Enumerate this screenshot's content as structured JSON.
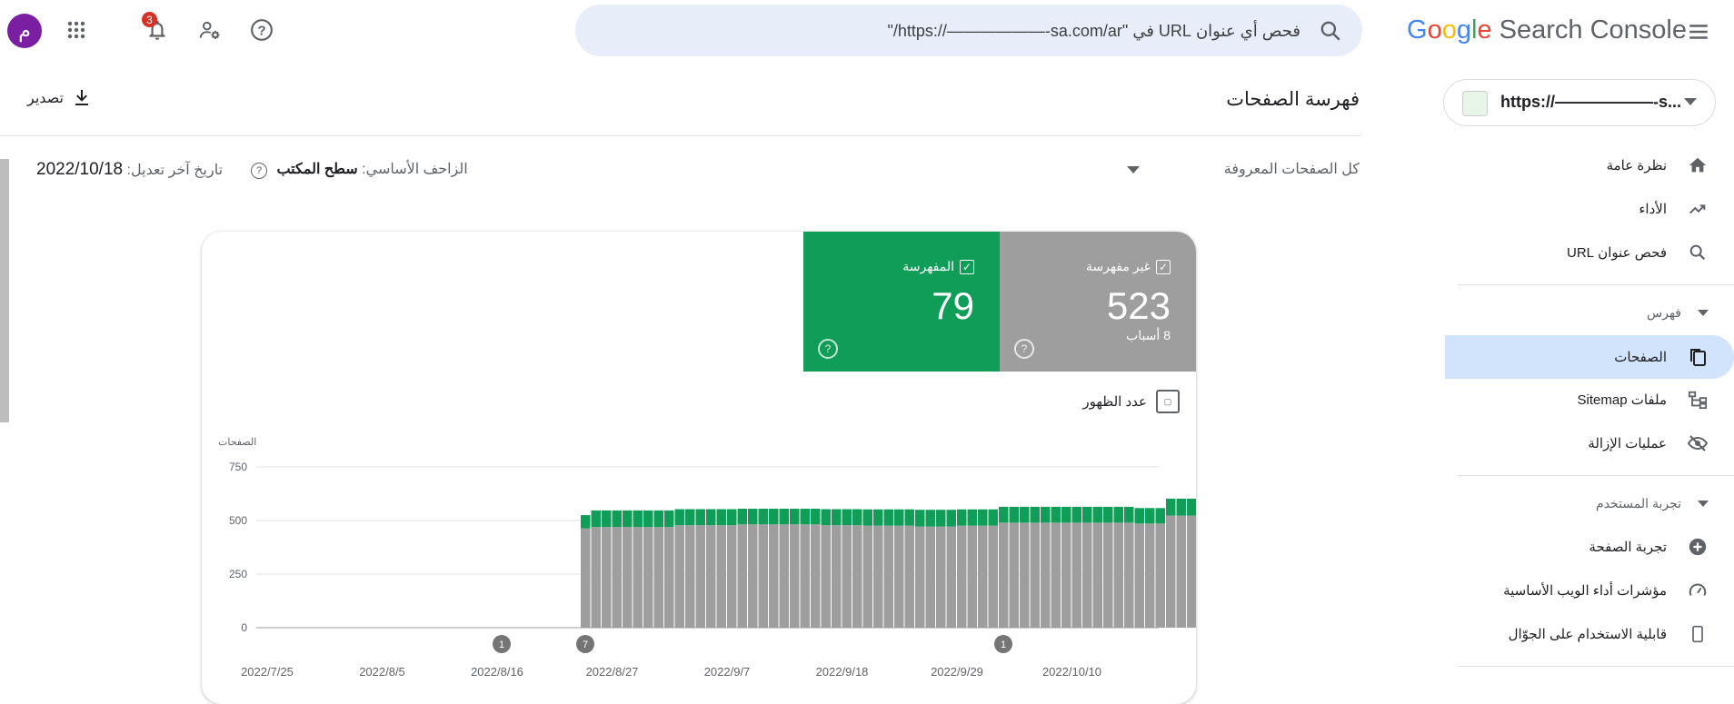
{
  "header": {
    "avatar_letter": "م",
    "notification_count": "3",
    "search_text": "فحص أي عنوان URL في \"https://――――――-sa.com/ar/\"",
    "logo_google": "Google",
    "logo_product": "Search Console"
  },
  "property": {
    "url": "https://――――――-s..."
  },
  "page": {
    "title": "فهرسة الصفحات",
    "export_label": "تصدير",
    "filter_label": "كل الصفحات المعروفة",
    "crawler_label": "الزاحف الأساسي:",
    "crawler_value": "سطح المكتب",
    "last_update_label": "تاريخ آخر تعديل:",
    "last_update_value": "2022/10/18"
  },
  "sidebar": {
    "overview": "نظرة عامة",
    "performance": "الأداء",
    "url_inspection": "فحص عنوان URL",
    "index_section": "فهرس",
    "pages": "الصفحات",
    "sitemaps": "ملفات Sitemap",
    "removals": "عمليات الإزالة",
    "experience_section": "تجربة المستخدم",
    "page_experience": "تجربة الصفحة",
    "core_web_vitals": "مؤشرات أداء الويب الأساسية",
    "mobile_usability": "قابلية الاستخدام على الجوّال"
  },
  "summary": {
    "not_indexed_label": "غير مفهرسة",
    "not_indexed_count": "523",
    "not_indexed_reasons": "8 أسباب",
    "indexed_label": "المفهرسة",
    "indexed_count": "79",
    "impressions_label": "عدد الظهور"
  },
  "colors": {
    "indexed": "#0f9d58",
    "not_indexed": "#9e9e9e",
    "active_nav": "#d2e3fc",
    "search_bg": "#e8eef9"
  },
  "chart_data": {
    "type": "bar",
    "ylabel": "الصفحات",
    "yticks": [
      "750",
      "500",
      "250",
      "0"
    ],
    "ylim": [
      0,
      750
    ],
    "x_ticks": [
      "2022/7/25",
      "2022/8/5",
      "2022/8/16",
      "2022/8/27",
      "2022/9/7",
      "2022/9/18",
      "2022/9/29",
      "2022/10/10"
    ],
    "annotations": [
      {
        "date": "2022/8/16",
        "label": "1"
      },
      {
        "date": "2022/8/24",
        "label": "7"
      },
      {
        "date": "2022/10/3",
        "label": "1"
      }
    ],
    "series": [
      {
        "name": "غير مفهرسة",
        "color": "#9e9e9e",
        "start_date": "2022/8/24",
        "values": [
          463,
          470,
          470,
          470,
          470,
          470,
          470,
          470,
          470,
          478,
          478,
          478,
          478,
          478,
          478,
          482,
          482,
          482,
          482,
          482,
          482,
          482,
          482,
          478,
          478,
          478,
          478,
          476,
          476,
          476,
          476,
          476,
          472,
          472,
          472,
          472,
          476,
          476,
          476,
          476,
          490,
          490,
          490,
          490,
          490,
          490,
          490,
          490,
          490,
          490,
          490,
          490,
          490,
          486,
          486,
          486,
          523,
          523,
          523,
          523,
          523
        ]
      },
      {
        "name": "المفهرسة",
        "color": "#0f9d58",
        "start_date": "2022/8/24",
        "values": [
          62,
          77,
          77,
          77,
          77,
          77,
          77,
          77,
          77,
          75,
          75,
          75,
          75,
          75,
          75,
          73,
          73,
          73,
          73,
          73,
          73,
          73,
          73,
          75,
          75,
          75,
          75,
          76,
          76,
          76,
          76,
          76,
          78,
          78,
          78,
          78,
          76,
          76,
          76,
          76,
          74,
          74,
          74,
          74,
          74,
          74,
          74,
          74,
          74,
          74,
          74,
          74,
          74,
          72,
          72,
          72,
          79,
          79,
          79,
          79,
          79
        ]
      }
    ]
  }
}
